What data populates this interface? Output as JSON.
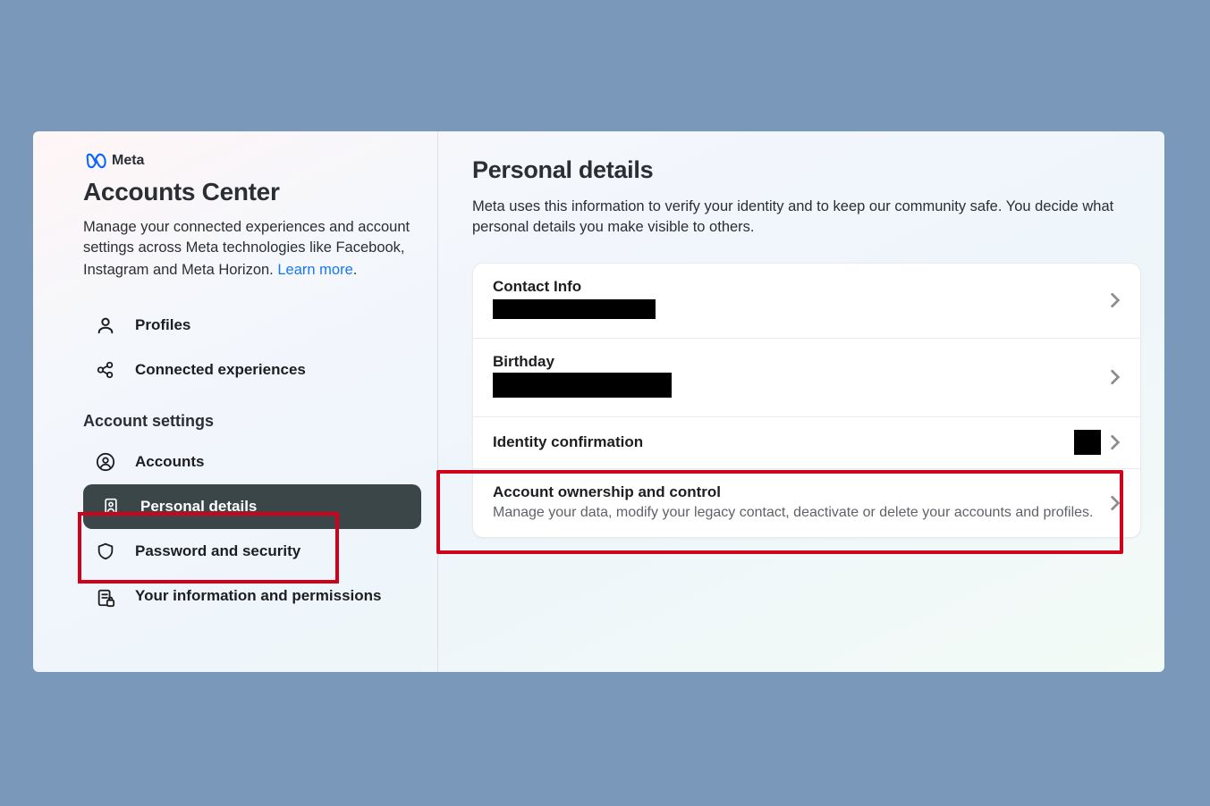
{
  "brand": {
    "text": "Meta"
  },
  "sidebar": {
    "title": "Accounts Center",
    "description": "Manage your connected experiences and account settings across Meta technologies like Facebook, Instagram and Meta Horizon.",
    "learn_more": "Learn more",
    "nav_top": [
      {
        "icon": "user",
        "label": "Profiles"
      },
      {
        "icon": "share",
        "label": "Connected experiences"
      }
    ],
    "section_label": "Account settings",
    "nav_settings": [
      {
        "icon": "account",
        "label": "Accounts"
      },
      {
        "icon": "badge",
        "label": "Personal details",
        "active": true
      },
      {
        "icon": "shield",
        "label": "Password and security"
      },
      {
        "icon": "doc",
        "label": "Your information and permissions"
      }
    ]
  },
  "main": {
    "title": "Personal details",
    "description": "Meta uses this information to verify your identity and to keep our community safe. You decide what personal details you make visible to others.",
    "rows": [
      {
        "title": "Contact Info",
        "redacted_value": true
      },
      {
        "title": "Birthday",
        "redacted_value": true
      },
      {
        "title": "Identity confirmation",
        "redacted_trailing": true
      },
      {
        "title": "Account ownership and control",
        "sub": "Manage your data, modify your legacy contact, deactivate or delete your accounts and profiles."
      }
    ]
  }
}
